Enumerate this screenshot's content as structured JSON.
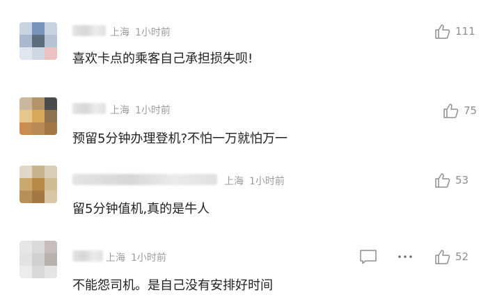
{
  "comments": [
    {
      "location": "上海",
      "time": "1小时前",
      "text": "喜欢卡点的乘客自己承担损失呗!",
      "likes": "111"
    },
    {
      "location": "上海",
      "time": "1小时前",
      "text": "预留5分钟办理登机?不怕一万就怕万一",
      "likes": "75"
    },
    {
      "location": "上海",
      "time": "1小时前",
      "text": "留5分钟值机,真的是牛人",
      "likes": "53"
    },
    {
      "location": "上海",
      "time": "1小时前",
      "text": "不能怨司机。是自己没有安排好时间",
      "likes": "52"
    }
  ],
  "icons": {
    "like": "thumbs-up-icon",
    "reply": "comment-bubble-icon",
    "more": "more-dots-icon"
  },
  "colors": {
    "text": "#222222",
    "meta": "#9b9b9b",
    "icon": "#8e8e8e"
  }
}
